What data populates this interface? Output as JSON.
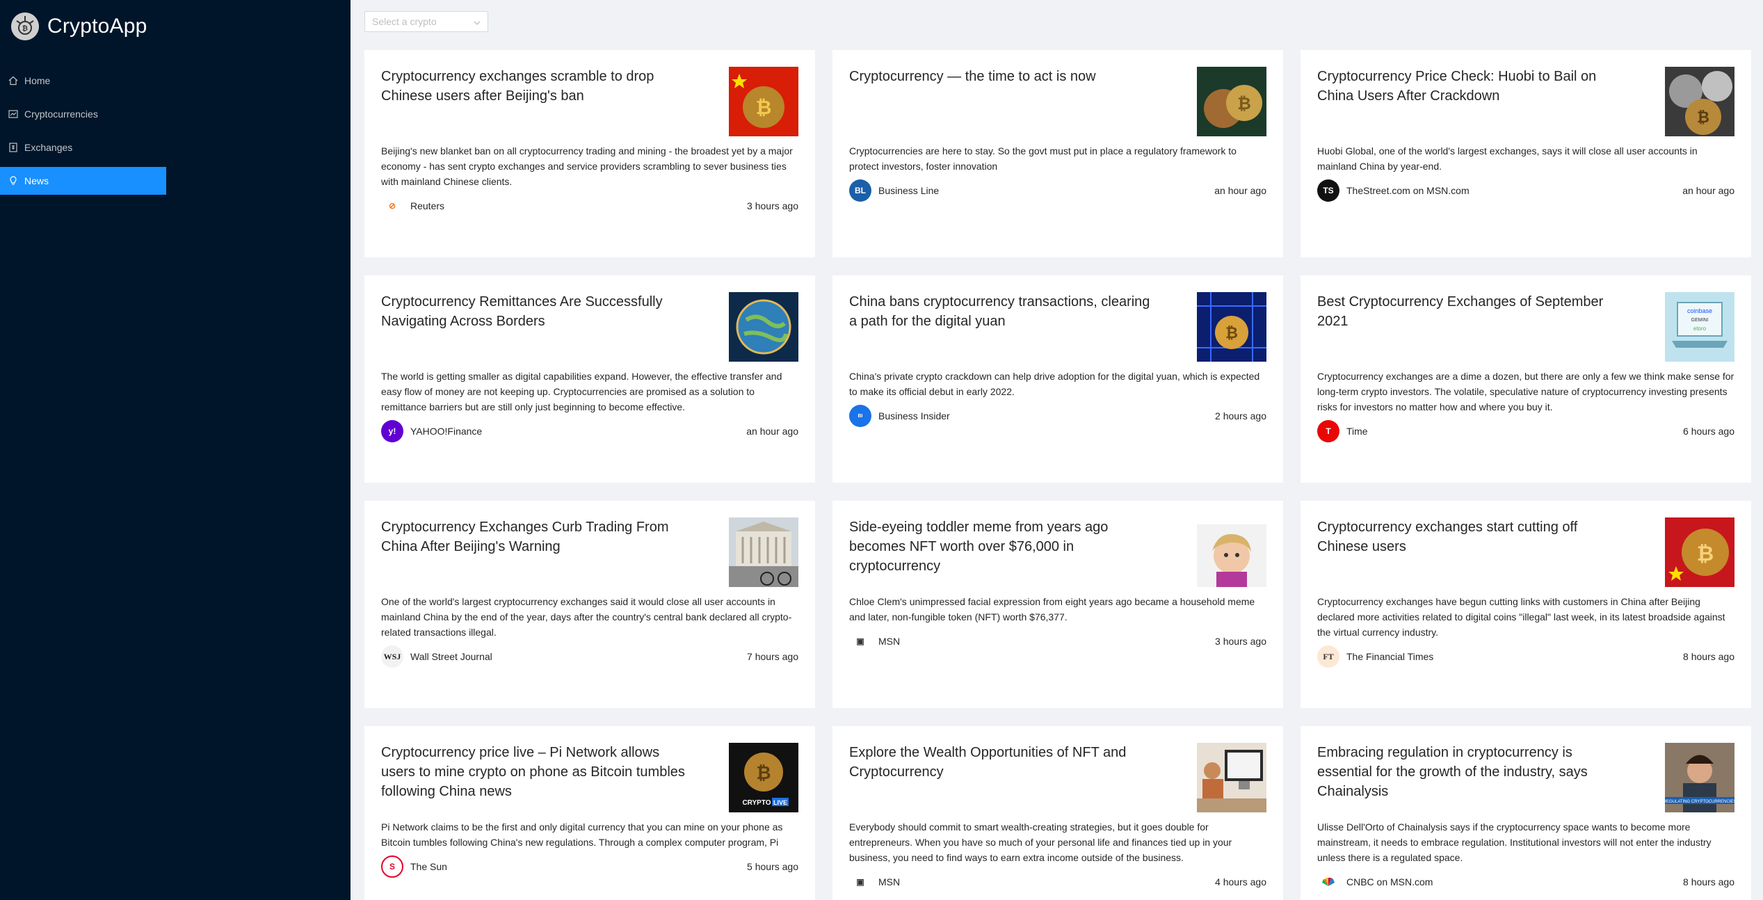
{
  "app": {
    "title": "CryptoApp"
  },
  "menu": [
    {
      "label": "Home",
      "icon": "home-icon",
      "selected": false
    },
    {
      "label": "Cryptocurrencies",
      "icon": "fund-icon",
      "selected": false
    },
    {
      "label": "Exchanges",
      "icon": "money-collect-icon",
      "selected": false
    },
    {
      "label": "News",
      "icon": "bulb-icon",
      "selected": true
    }
  ],
  "search": {
    "placeholder": "Select a crypto"
  },
  "colors": {
    "sidebar": "#001529",
    "accent": "#1890ff",
    "background": "#f0f2f5"
  },
  "news": [
    {
      "title": "Cryptocurrency exchanges scramble to drop Chinese users after Beijing's ban",
      "description": "Beijing's new blanket ban on all cryptocurrency trading and mining - the broadest yet by a major economy - has sent crypto exchanges and service providers scrambling to sever business ties with mainland Chinese clients.",
      "provider": "Reuters",
      "time": "3 hours ago",
      "thumb": "bitcoin-china-flag-image"
    },
    {
      "title": "Cryptocurrency — the time to act is now",
      "description": "Cryptocurrencies are here to stay. So the govt must put in place a regulatory framework to protect investors, foster innovation",
      "provider": "Business Line",
      "time": "an hour ago",
      "thumb": "coins-image"
    },
    {
      "title": "Cryptocurrency Price Check: Huobi to Bail on China Users After Crackdown",
      "description": "Huobi Global, one of the world's largest exchanges, says it will close all user accounts in mainland China by year-end.",
      "provider": "TheStreet.com on MSN.com",
      "time": "an hour ago",
      "thumb": "crypto-coins-image"
    },
    {
      "title": "Cryptocurrency Remittances Are Successfully Navigating Across Borders",
      "description": "The world is getting smaller as digital capabilities expand. However, the effective transfer and easy flow of money are not keeping up. Cryptocurrencies are promised as a solution to remittance barriers but are still only just beginning to become effective.",
      "provider": "YAHOO!Finance",
      "time": "an hour ago",
      "thumb": "globe-image"
    },
    {
      "title": "China bans cryptocurrency transactions, clearing a path for the digital yuan",
      "description": "China's private crypto crackdown can help drive adoption for the digital yuan, which is expected to make its official debut in early 2022.",
      "provider": "Business Insider",
      "time": "2 hours ago",
      "thumb": "bitcoin-circuit-image"
    },
    {
      "title": "Best Cryptocurrency Exchanges of September 2021",
      "description": "Cryptocurrency exchanges are a dime a dozen, but there are only a few we think make sense for long-term crypto investors. The volatile, speculative nature of cryptocurrency investing presents risks for investors no matter how and where you buy it.",
      "provider": "Time",
      "time": "6 hours ago",
      "thumb": "laptop-exchanges-image"
    },
    {
      "title": "Cryptocurrency Exchanges Curb Trading From China After Beijing's Warning",
      "description": "One of the world's largest cryptocurrency exchanges said it would close all user accounts in mainland China by the end of the year, days after the country's central bank declared all crypto-related transactions illegal.",
      "provider": "Wall Street Journal",
      "time": "7 hours ago",
      "thumb": "bank-building-image"
    },
    {
      "title": "Side-eyeing toddler meme from years ago becomes NFT worth over $76,000 in cryptocurrency",
      "description": "Chloe Clem's unimpressed facial expression from eight years ago became a household meme and later, non-fungible token (NFT) worth $76,377.",
      "provider": "MSN",
      "time": "3 hours ago",
      "thumb": "toddler-meme-image"
    },
    {
      "title": "Cryptocurrency exchanges start cutting off Chinese users",
      "description": "Cryptocurrency exchanges have begun cutting links with customers in China after Beijing declared more activities related to digital coins \"illegal\" last week, in its latest broadside against the virtual currency industry.",
      "provider": "The Financial Times",
      "time": "8 hours ago",
      "thumb": "bitcoin-china-flag-image"
    },
    {
      "title": "Cryptocurrency price live – Pi Network allows users to mine crypto on phone as Bitcoin tumbles following China news",
      "description": "Pi Network claims to be the first and only digital currency that you can mine on your phone as Bitcoin tumbles following China's new regulations. Through a complex computer program, Pi",
      "provider": "The Sun",
      "time": "5 hours ago",
      "thumb": "crypto-live-image",
      "thumb_label": "CRYPTO LIVE"
    },
    {
      "title": "Explore the Wealth Opportunities of NFT and Cryptocurrency",
      "description": "Everybody should commit to smart wealth-creating strategies, but it goes double for entrepreneurs. When you have so much of your personal life and finances tied up in your business, you need to find ways to earn extra income outside of the business.",
      "provider": "MSN",
      "time": "4 hours ago",
      "thumb": "computer-desk-image"
    },
    {
      "title": "Embracing regulation in cryptocurrency is essential for the growth of the industry, says Chainalysis",
      "description": "Ulisse Dell'Orto of Chainalysis says if the cryptocurrency space wants to become more mainstream, it needs to embrace regulation. Institutional investors will not enter the industry unless there is a regulated space.",
      "provider": "CNBC on MSN.com",
      "time": "8 hours ago",
      "thumb": "interview-image"
    }
  ]
}
